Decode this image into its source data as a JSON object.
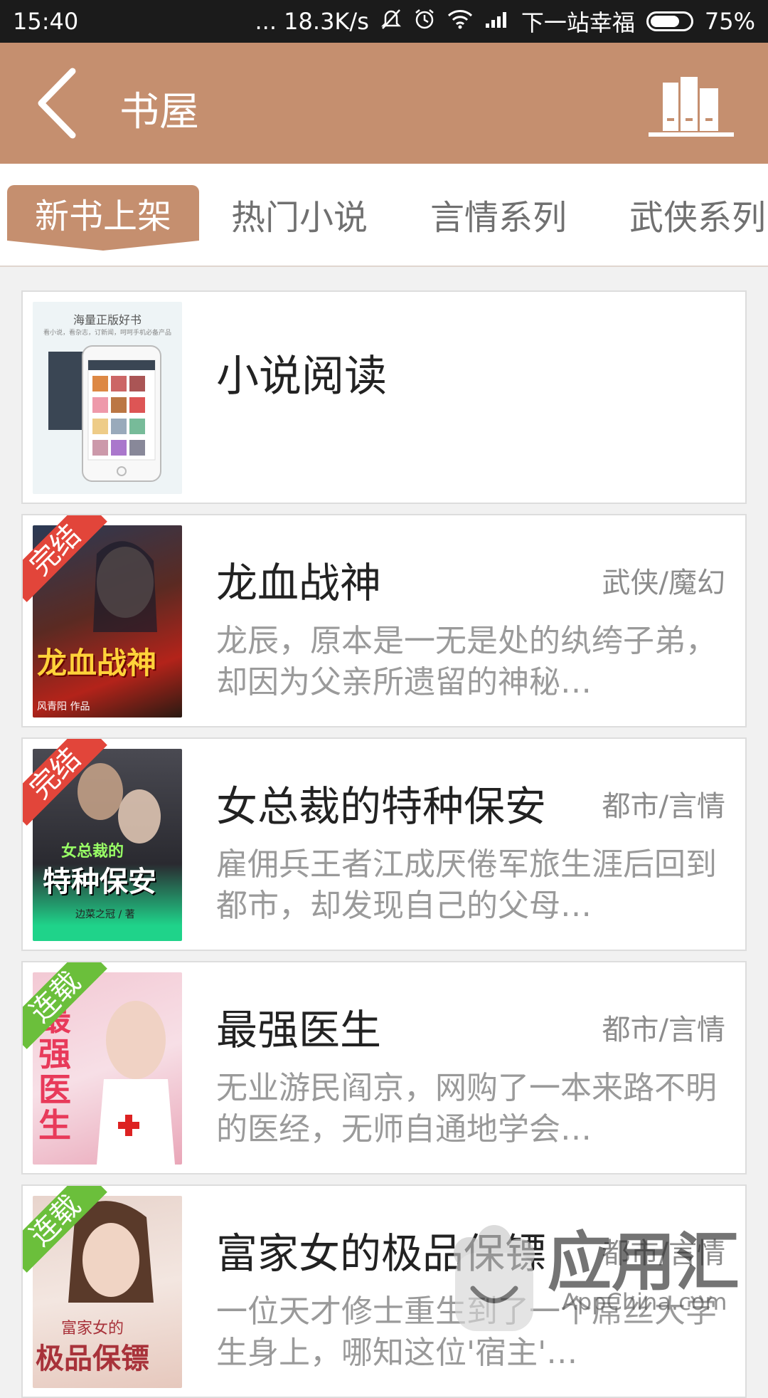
{
  "status_bar": {
    "time": "15:40",
    "net_speed": "... 18.3K/s",
    "carrier": "下一站幸福",
    "battery": "75%"
  },
  "header": {
    "title": "书屋",
    "back_icon": "chevron-left-icon",
    "shelf_icon": "bookshelf-icon"
  },
  "tabs": [
    {
      "label": "新书上架",
      "active": true
    },
    {
      "label": "热门小说",
      "active": false
    },
    {
      "label": "言情系列",
      "active": false
    },
    {
      "label": "武侠系列",
      "active": false
    }
  ],
  "ad_card": {
    "title": "小说阅读",
    "cover_heading": "海量正版好书",
    "cover_sub": "看小说，看杂志，订新闻，呵呵手机必备产品"
  },
  "books": [
    {
      "title": "龙血战神",
      "genre": "武侠/魔幻",
      "desc": "龙辰，原本是一无是处的纨绔子弟，却因为父亲所遗留的神秘…",
      "status": "完结",
      "status_color": "#e2453a",
      "cover_text": "龙血战神",
      "author_tag": "风青阳 作品"
    },
    {
      "title": "女总裁的特种保安",
      "genre": "都市/言情",
      "desc": "雇佣兵王者江成厌倦军旅生涯后回到都市，却发现自己的父母…",
      "status": "完结",
      "status_color": "#e2453a",
      "cover_text": "特种保安",
      "cover_small": "女总裁的",
      "author_tag": "边菜之冠 / 著"
    },
    {
      "title": "最强医生",
      "genre": "都市/言情",
      "desc": "无业游民阎京，网购了一本来路不明的医经，无师自通地学会…",
      "status": "连载",
      "status_color": "#6bbf3b",
      "cover_text": "最强医生"
    },
    {
      "title": "富家女的极品保镖",
      "genre": "都市/言情",
      "desc": "一位天才修士重生到了一个屌丝大学生身上，哪知这位'宿主'…",
      "status": "连载",
      "status_color": "#6bbf3b",
      "cover_text": "极品保镖",
      "cover_small": "富家女的"
    }
  ],
  "watermark": {
    "brand": "应用汇",
    "url": "AppChina.com"
  },
  "colors": {
    "accent": "#c58f6f",
    "completed": "#e2453a",
    "serializing": "#6bbf3b"
  }
}
